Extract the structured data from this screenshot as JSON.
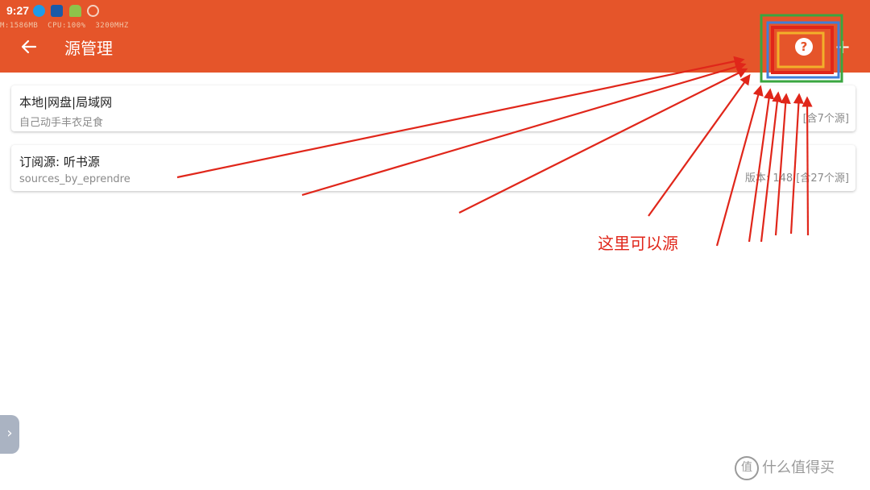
{
  "status_bar": {
    "time": "9:27",
    "perf": "M:1586MB  CPU:100%  3200MHZ"
  },
  "app_bar": {
    "title": "源管理",
    "back_icon": "arrow-left-icon",
    "help_icon": "help-circle-icon",
    "help_glyph": "?",
    "add_icon": "plus-icon",
    "add_glyph": "+",
    "color": "#e5552a"
  },
  "sources": [
    {
      "name": "本地|网盘|局域网",
      "subtitle": "自己动手丰衣足食",
      "meta": "[含7个源]"
    },
    {
      "name": "订阅源: 听书源",
      "subtitle": "sources_by_eprendre",
      "meta": "版本: 148 [含27个源]"
    }
  ],
  "side_handle": {
    "glyph": "›",
    "icon": "chevron-right-icon"
  },
  "annotation": {
    "text": "这里可以源",
    "color": "#e0261a"
  },
  "watermark": {
    "text": "什么值得买",
    "icon_glyph": "值"
  }
}
